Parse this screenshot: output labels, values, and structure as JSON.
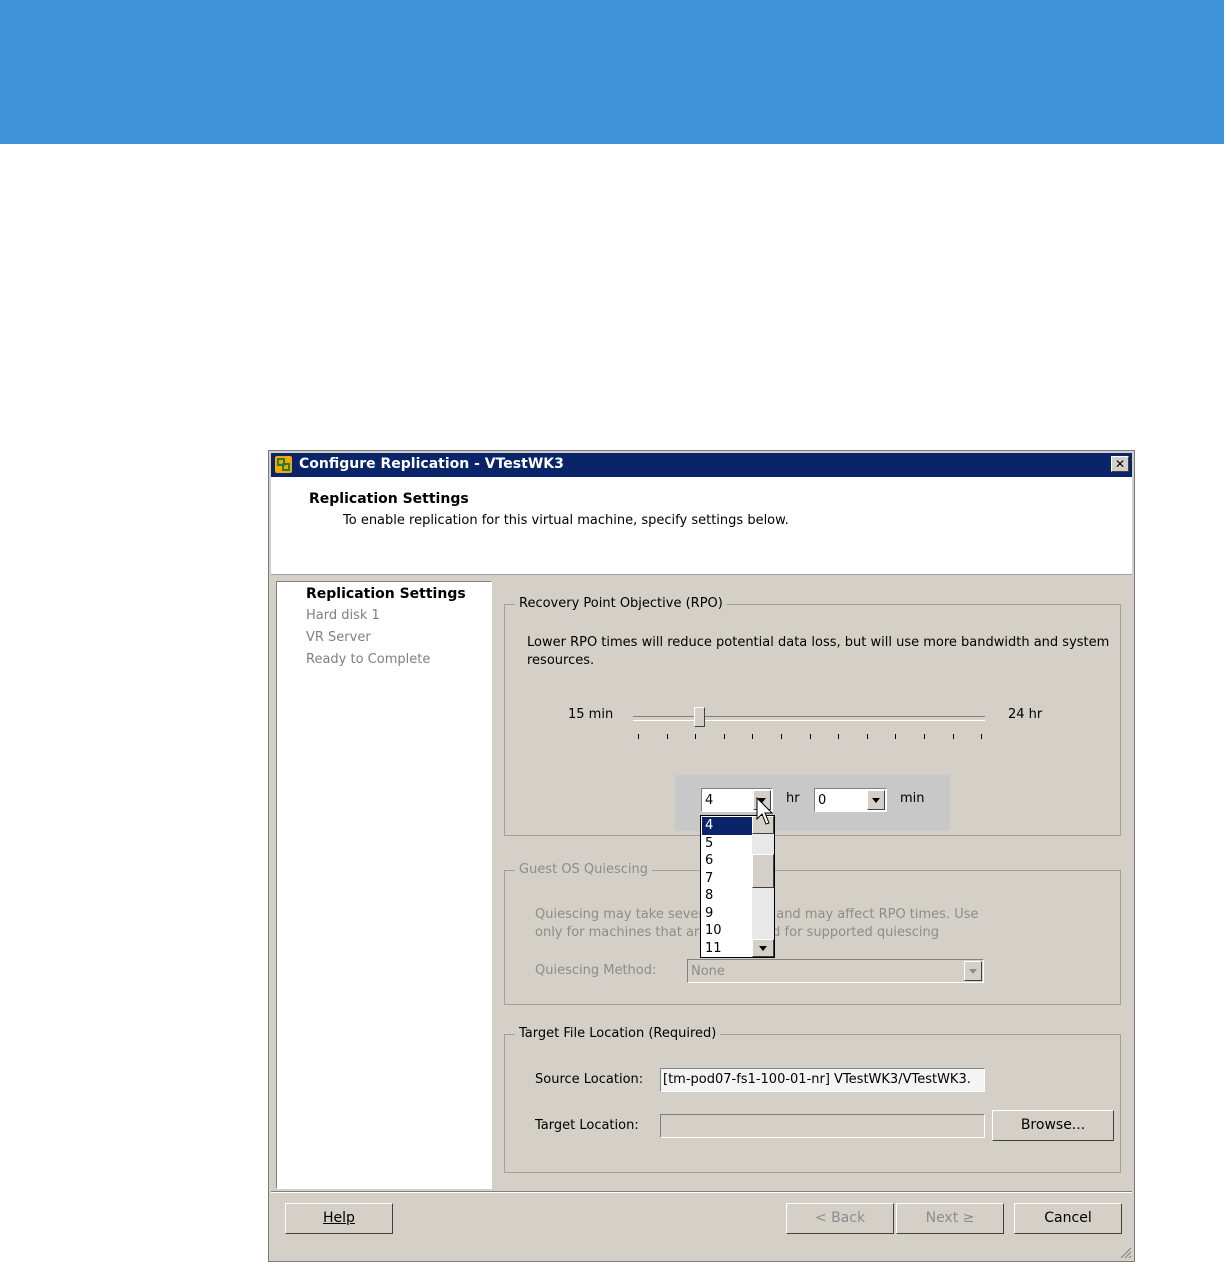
{
  "window": {
    "title": "Configure Replication - VTestWK3",
    "close_label": "✕"
  },
  "header": {
    "title": "Replication Settings",
    "subtitle": "To enable replication for this virtual machine, specify settings below."
  },
  "nav": {
    "items": [
      {
        "label": "Replication Settings",
        "active": true
      },
      {
        "label": "Hard disk 1"
      },
      {
        "label": "VR Server"
      },
      {
        "label": "Ready to Complete"
      }
    ]
  },
  "rpo": {
    "legend": "Recovery Point Objective (RPO)",
    "description": "Lower RPO times will reduce potential data loss, but will use more bandwidth and system resources.",
    "slider_min_label": "15 min",
    "slider_max_label": "24 hr",
    "slider_level": 0.18,
    "hours_value": "4",
    "hours_unit": "hr",
    "minutes_value": "0",
    "minutes_unit": "min",
    "hours_dropdown_options": [
      "4",
      "5",
      "6",
      "7",
      "8",
      "9",
      "10",
      "11"
    ],
    "hours_dropdown_selected": "4"
  },
  "quiescing": {
    "legend": "Guest OS Quiescing",
    "description_line1": "Quiescing may take several minutes and may affect RPO times. Use",
    "description_line2": "only for machines that are configured for supported quiescing",
    "method_label": "Quiescing Method:",
    "method_value": "None"
  },
  "target": {
    "legend": "Target File Location (Required)",
    "source_label": "Source Location:",
    "source_value": "[tm-pod07-fs1-100-01-nr] VTestWK3/VTestWK3.",
    "target_label": "Target Location:",
    "target_value": "",
    "browse_label": "Browse..."
  },
  "footer": {
    "help_label": "Help",
    "back_label": "< Back",
    "next_label": "Next ≥",
    "cancel_label": "Cancel"
  },
  "colors": {
    "banner": "#4093d6",
    "titlebar": "#0a246a",
    "selection": "#0a246a"
  }
}
